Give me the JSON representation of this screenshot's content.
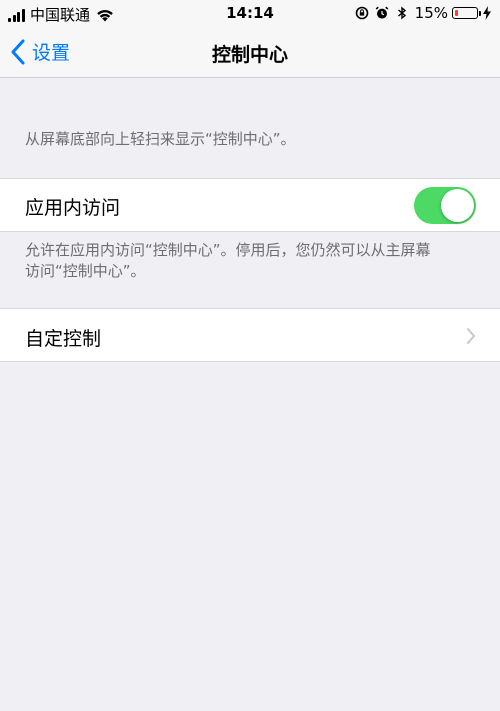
{
  "status_bar": {
    "carrier": "中国联通",
    "time": "14:14",
    "battery_percent": "15%",
    "battery_level": 0.15,
    "battery_color": "#ff3b30",
    "icons": [
      "signal-icon",
      "wifi-icon",
      "rotation-lock-icon",
      "alarm-icon",
      "bluetooth-icon",
      "battery-icon",
      "charging-icon"
    ]
  },
  "nav": {
    "back_label": "设置",
    "title": "控制中心",
    "accent_color": "#007aff"
  },
  "main": {
    "top_description": "从屏幕底部向上轻扫来显示“控制中心”。",
    "access_within_apps": {
      "label": "应用内访问",
      "toggle_on": true,
      "toggle_color": "#4cd964"
    },
    "access_description_line1": "允许在应用内访问“控制中心”。停用后，您仍然可以从主屏幕",
    "access_description_line2": "访问“控制中心”。",
    "customize": {
      "label": "自定控制",
      "icon": "chevron-right-icon"
    }
  }
}
